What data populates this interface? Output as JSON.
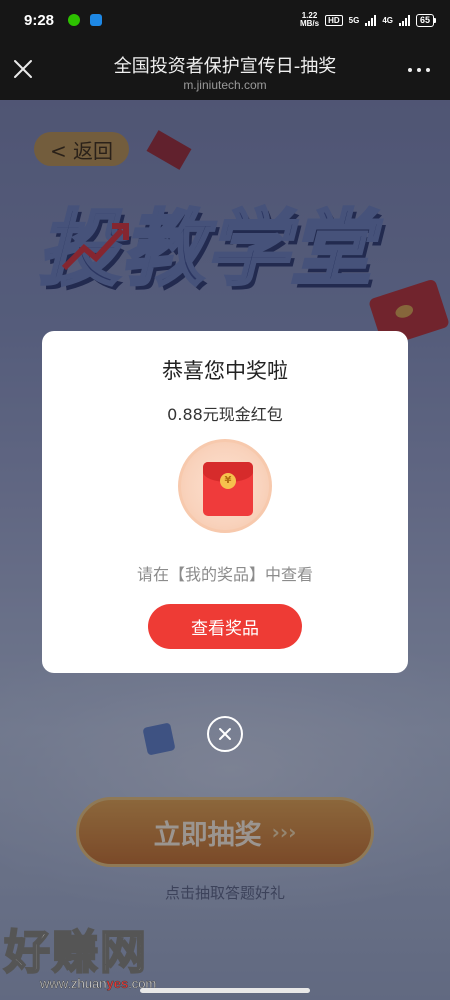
{
  "status_bar": {
    "time": "9:28",
    "speed_value": "1.22",
    "speed_unit": "MB/s",
    "hd_tag": "HD",
    "net_1": "5G",
    "net_2": "4G",
    "battery": "65"
  },
  "title_bar": {
    "title": "全国投资者保护宣传日-抽奖",
    "url": "m.jiniutech.com"
  },
  "page": {
    "back_label": "< 返回",
    "banner_title": "投教学堂",
    "draw_button": "立即抽奖",
    "draw_arrows": "›››",
    "draw_hint": "点击抽取答题好礼"
  },
  "watermark": {
    "text": "好赚网",
    "url_pre": "www.zhuan",
    "url_mid": "yes",
    "url_post": ".com"
  },
  "modal": {
    "title": "恭喜您中奖啦",
    "amount": "0.88元现金红包",
    "coin_symbol": "¥",
    "hint": "请在【我的奖品】中查看",
    "button": "查看奖品"
  },
  "colors": {
    "accent_red": "#ee3b35",
    "wechat_green": "#2dc100",
    "app_blue": "#1e88e5"
  }
}
